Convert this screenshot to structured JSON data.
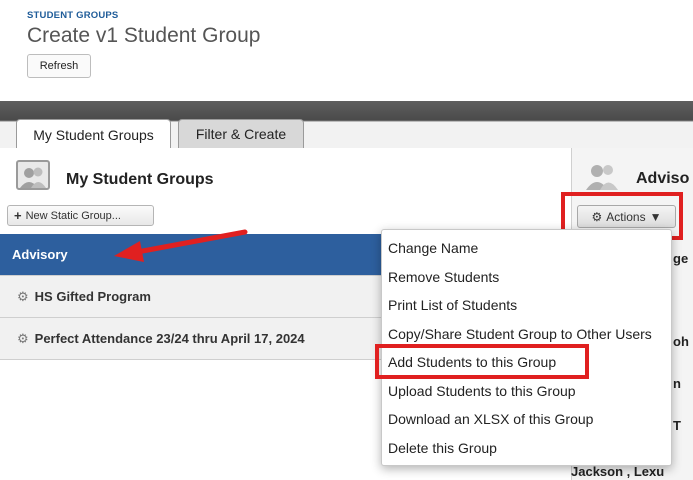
{
  "header": {
    "breadcrumb": "STUDENT GROUPS",
    "title": "Create v1 Student Group",
    "refresh_label": "Refresh"
  },
  "tabs": [
    {
      "label": "My Student Groups",
      "active": true
    },
    {
      "label": "Filter & Create",
      "active": false
    }
  ],
  "left_panel": {
    "title": "My Student Groups",
    "new_group_label": "New Static Group...",
    "groups": [
      {
        "label": "Advisory",
        "selected": true
      },
      {
        "label": "HS Gifted Program",
        "selected": false
      },
      {
        "label": "Perfect Attendance 23/24 thru April 17, 2024",
        "selected": false
      }
    ]
  },
  "right_panel": {
    "title": "Adviso",
    "actions_label": "Actions",
    "visible_fragments": [
      "ge",
      "oh",
      "n",
      "T",
      "Jackson , Lexu"
    ]
  },
  "actions_menu": {
    "items": [
      "Change Name",
      "Remove Students",
      "Print List of Students",
      "Copy/Share Student Group to Other Users",
      "Add Students to this Group",
      "Upload Students to this Group",
      "Download an XLSX of this Group",
      "Delete this Group"
    ],
    "highlighted_item": "Upload Students to this Group"
  },
  "colors": {
    "selected_row": "#2d5f9e",
    "highlight": "#e02020",
    "breadcrumb": "#1f5c99"
  },
  "icons": [
    "people-icon",
    "plus-icon",
    "gear-icon",
    "dropdown-triangle-icon",
    "red-arrow-icon"
  ]
}
